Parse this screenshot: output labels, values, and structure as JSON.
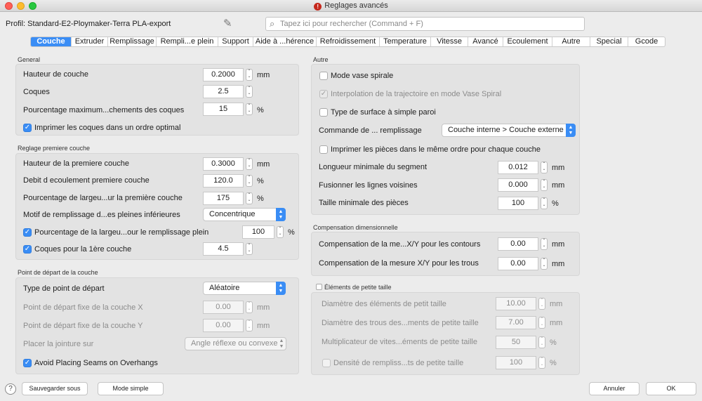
{
  "window": {
    "title": "Reglages avancés"
  },
  "header": {
    "profile_label": "Profil: Standard-E2-Ploymaker-Terra PLA-export",
    "search_placeholder": "Tapez ici pour rechercher (Command + F)"
  },
  "tabs": [
    {
      "label": "Couche"
    },
    {
      "label": "Extruder"
    },
    {
      "label": "Remplissage"
    },
    {
      "label": "Rempli...e plein"
    },
    {
      "label": "Support"
    },
    {
      "label": "Aide à ...hérence"
    },
    {
      "label": "Refroidissement"
    },
    {
      "label": "Temperature"
    },
    {
      "label": "Vitesse"
    },
    {
      "label": "Avancé"
    },
    {
      "label": "Ecoulement"
    },
    {
      "label": "Autre"
    },
    {
      "label": "Special"
    },
    {
      "label": "Gcode"
    }
  ],
  "general": {
    "title": "General",
    "hauteur_label": "Hauteur de couche",
    "hauteur_value": "0.2000",
    "hauteur_unit": "mm",
    "coques_label": "Coques",
    "coques_value": "2.5",
    "pct_label": "Pourcentage maximum...chements des coques",
    "pct_value": "15",
    "pct_unit": "%",
    "ordre_label": "Imprimer les coques dans un ordre optimal"
  },
  "first_layer": {
    "title": "Reglage premiere couche",
    "hauteur_label": "Hauteur de la premiere couche",
    "hauteur_value": "0.3000",
    "hauteur_unit": "mm",
    "debit_label": "Debit d ecoulement premiere couche",
    "debit_value": "120.0",
    "debit_unit": "%",
    "largeur_label": "Pourcentage de largeu...ur la première couche",
    "largeur_value": "175",
    "largeur_unit": "%",
    "motif_label": "Motif de remplissage d...es pleines inférieures",
    "motif_value": "Concentrique",
    "plein_label": "Pourcentage de la largeu...our le remplissage plein",
    "plein_value": "100",
    "plein_unit": "%",
    "coques_label": "Coques pour la 1ère couche",
    "coques_value": "4.5"
  },
  "start_point": {
    "title": "Point de départ de la couche",
    "type_label": "Type de point de départ",
    "type_value": "Aléatoire",
    "fixe_x_label": "Point de départ fixe de la couche X",
    "fixe_x_value": "0.00",
    "fixe_x_unit": "mm",
    "fixe_y_label": "Point de départ fixe de la couche Y",
    "fixe_y_value": "0.00",
    "fixe_y_unit": "mm",
    "jointure_label": "Placer la jointure sur",
    "jointure_value": "Angle réflexe ou convexe",
    "avoid_label": "Avoid Placing Seams on Overhangs"
  },
  "autre": {
    "title": "Autre",
    "vase_label": "Mode vase spirale",
    "interp_label": "Interpolation de la trajectoire en mode Vase Spiral",
    "surface_label": "Type de surface à simple paroi",
    "commande_label": "Commande de ... remplissage",
    "commande_value": "Couche interne > Couche externe",
    "ordre_label": "Imprimer les pièces dans le même ordre pour chaque couche",
    "longueur_label": "Longueur minimale du segment",
    "longueur_value": "0.012",
    "longueur_unit": "mm",
    "fusion_label": "Fusionner les lignes voisines",
    "fusion_value": "0.000",
    "fusion_unit": "mm",
    "taille_label": "Taille minimale des pièces",
    "taille_value": "100",
    "taille_unit": "%"
  },
  "compensation": {
    "title": "Compensation dimensionnelle",
    "contours_label": "Compensation de la me...X/Y pour les contours",
    "contours_value": "0.00",
    "contours_unit": "mm",
    "trous_label": "Compensation de la mesure X/Y pour les trous",
    "trous_value": "0.00",
    "trous_unit": "mm"
  },
  "small": {
    "title": "Éléments de petite taille",
    "diam_label": "Diamètre des éléments de petit taille",
    "diam_value": "10.00",
    "diam_unit": "mm",
    "trous_label": "Diamètre des trous des...ments de petite taille",
    "trous_value": "7.00",
    "trous_unit": "mm",
    "mult_label": "Multiplicateur de vites...éments de petite taille",
    "mult_value": "50",
    "mult_unit": "%",
    "dens_label": "Densité de rempliss...ts de petite taille",
    "dens_value": "100",
    "dens_unit": "%"
  },
  "footer": {
    "help": "?",
    "save_as": "Sauvegarder sous",
    "simple": "Mode simple",
    "cancel": "Annuler",
    "ok": "OK"
  },
  "icons": {
    "check": "✓",
    "stepper": "⌃⌄",
    "select_arrow": "⌃⌄"
  },
  "colors": {
    "accent": "#3a8df5",
    "panel": "#e3e3e3",
    "background": "#ececec"
  }
}
